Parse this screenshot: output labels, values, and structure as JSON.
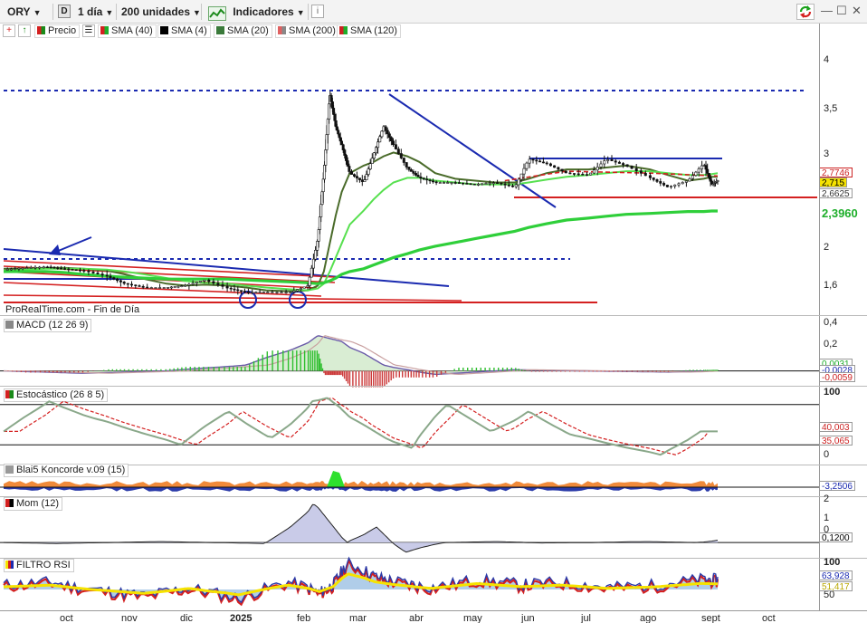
{
  "toolbar": {
    "symbol": "ORY",
    "period_badge": "D",
    "timeframe": "1 día",
    "units": "200 unidades",
    "indicators_label": "Indicadores",
    "info_icon": "info-icon",
    "window_controls": [
      "minimize-icon",
      "restore-icon",
      "close-icon"
    ]
  },
  "legend": {
    "items": [
      {
        "label": "Precio",
        "color": "#2e8b2e"
      },
      {
        "label": "SMA (40)",
        "color": "#1e9e1e"
      },
      {
        "label": "SMA (4)",
        "color": "#000000"
      },
      {
        "label": "SMA (20)",
        "color": "#2e8b57"
      },
      {
        "label": "SMA (200)",
        "color": "#e06060"
      },
      {
        "label": "SMA (120)",
        "color": "#cc2222"
      }
    ]
  },
  "watermark": "ProRealTime.com - Fin de Día",
  "price_axis": {
    "ticks": [
      "4",
      "3,5",
      "3",
      "2",
      "1,6"
    ]
  },
  "price_tags": [
    {
      "value": "2,7746",
      "color": "#cc2222"
    },
    {
      "value": "2,715",
      "color": "#000000"
    },
    {
      "value": "2,6625",
      "color": "#333333"
    },
    {
      "value": "2,3960",
      "color": "#1eae2a"
    }
  ],
  "panels": {
    "macd": {
      "title": "MACD (12 26 9)",
      "ticks": [
        "0,4",
        "0,2",
        "0"
      ],
      "tags": [
        "0,0031",
        "-0,0028",
        "-0,0059"
      ]
    },
    "stoch": {
      "title": "Estocástico (26 8 5)",
      "ticks": [
        "100",
        "0"
      ],
      "tags": [
        "40,003",
        "35,065"
      ]
    },
    "koncorde": {
      "title": "Blai5 Koncorde v.09 (15)",
      "tags": [
        "-3,2506"
      ]
    },
    "mom": {
      "title": "Mom (12)",
      "ticks": [
        "2",
        "1",
        "0"
      ],
      "tags": [
        "0,1200"
      ]
    },
    "rsi": {
      "title": "FILTRO RSI",
      "ticks": [
        "100",
        "50"
      ],
      "tags": [
        "63,928",
        "51,417"
      ]
    }
  },
  "x_axis": {
    "labels": [
      {
        "label": "oct",
        "bold": false
      },
      {
        "label": "nov",
        "bold": false
      },
      {
        "label": "dic",
        "bold": false
      },
      {
        "label": "2025",
        "bold": true
      },
      {
        "label": "feb",
        "bold": false
      },
      {
        "label": "mar",
        "bold": false
      },
      {
        "label": "abr",
        "bold": false
      },
      {
        "label": "may",
        "bold": false
      },
      {
        "label": "jun",
        "bold": false
      },
      {
        "label": "jul",
        "bold": false
      },
      {
        "label": "ago",
        "bold": false
      },
      {
        "label": "sept",
        "bold": false
      },
      {
        "label": "oct",
        "bold": false
      }
    ]
  },
  "chart_data": {
    "type": "line",
    "subtype": "candlestick price chart with indicator panels",
    "symbol": "ORY",
    "timeframe": "1 día",
    "x": [
      "2024-09-10",
      "2024-09-20",
      "2024-10-01",
      "2024-10-10",
      "2024-10-20",
      "2024-11-01",
      "2024-11-10",
      "2024-11-20",
      "2024-12-01",
      "2024-12-10",
      "2024-12-20",
      "2025-01-01",
      "2025-01-10",
      "2025-01-20",
      "2025-02-01",
      "2025-02-10",
      "2025-02-15",
      "2025-02-18",
      "2025-02-21",
      "2025-02-24",
      "2025-02-27",
      "2025-03-03",
      "2025-03-10",
      "2025-03-15",
      "2025-03-20",
      "2025-03-25",
      "2025-04-01",
      "2025-04-07",
      "2025-04-15",
      "2025-04-25",
      "2025-05-05",
      "2025-05-15",
      "2025-05-25",
      "2025-06-01",
      "2025-06-10",
      "2025-06-20",
      "2025-07-01",
      "2025-07-10",
      "2025-07-20",
      "2025-08-01",
      "2025-08-10",
      "2025-08-20",
      "2025-08-28",
      "2025-09-01",
      "2025-09-04"
    ],
    "series": [
      {
        "name": "Precio",
        "values": [
          1.77,
          1.79,
          1.8,
          1.78,
          1.76,
          1.7,
          1.62,
          1.58,
          1.58,
          1.6,
          1.66,
          1.57,
          1.53,
          1.53,
          1.53,
          1.6,
          2.1,
          2.8,
          3.65,
          3.3,
          3.1,
          2.8,
          2.7,
          3.0,
          3.3,
          3.1,
          2.85,
          2.75,
          2.7,
          2.7,
          2.68,
          2.7,
          2.65,
          2.95,
          2.9,
          2.8,
          2.78,
          2.95,
          2.88,
          2.75,
          2.65,
          2.72,
          2.9,
          2.68,
          2.72
        ]
      },
      {
        "name": "SMA (20)",
        "values": [
          1.78,
          1.78,
          1.79,
          1.79,
          1.78,
          1.76,
          1.72,
          1.67,
          1.62,
          1.6,
          1.61,
          1.6,
          1.58,
          1.55,
          1.54,
          1.55,
          1.6,
          1.75,
          2.05,
          2.35,
          2.6,
          2.8,
          2.88,
          2.92,
          2.98,
          3.02,
          2.98,
          2.92,
          2.8,
          2.74,
          2.72,
          2.7,
          2.7,
          2.74,
          2.8,
          2.84,
          2.84,
          2.86,
          2.88,
          2.84,
          2.78,
          2.72,
          2.74,
          2.76,
          2.76
        ]
      },
      {
        "name": "SMA (40)",
        "values": [
          1.76,
          1.77,
          1.78,
          1.78,
          1.78,
          1.77,
          1.75,
          1.72,
          1.68,
          1.65,
          1.63,
          1.62,
          1.6,
          1.58,
          1.56,
          1.55,
          1.57,
          1.62,
          1.75,
          1.9,
          2.05,
          2.25,
          2.4,
          2.52,
          2.62,
          2.7,
          2.75,
          2.75,
          2.72,
          2.7,
          2.68,
          2.68,
          2.68,
          2.7,
          2.73,
          2.76,
          2.78,
          2.8,
          2.82,
          2.82,
          2.8,
          2.78,
          2.78,
          2.79,
          2.8
        ]
      },
      {
        "name": "SMA (120)",
        "values": [
          1.75,
          1.75,
          1.75,
          1.74,
          1.72,
          1.7,
          1.69,
          1.68,
          1.67,
          1.67,
          1.67,
          1.67,
          1.66,
          1.65,
          1.64,
          1.63,
          1.62,
          1.63,
          1.65,
          1.68,
          1.72,
          1.75,
          1.78,
          1.82,
          1.86,
          1.9,
          1.94,
          1.98,
          2.02,
          2.06,
          2.1,
          2.14,
          2.18,
          2.22,
          2.26,
          2.3,
          2.32,
          2.34,
          2.36,
          2.37,
          2.38,
          2.39,
          2.39,
          2.396,
          2.396
        ]
      }
    ],
    "levels": [
      {
        "label": "resistance (dashed)",
        "value": 3.7
      },
      {
        "label": "support (dashed)",
        "value": 1.89
      },
      {
        "label": "range top",
        "value": 2.98
      },
      {
        "label": "range bottom",
        "value": 2.63
      },
      {
        "label": "low support",
        "value": 1.55
      }
    ],
    "ylim": [
      1.45,
      4.3
    ],
    "indicators": {
      "macd": {
        "x": [
          "2024-10",
          "2024-12",
          "2025-01",
          "2025-02",
          "2025-03",
          "2025-03-20",
          "2025-04",
          "2025-05",
          "2025-06",
          "2025-07",
          "2025-08",
          "2025-09"
        ],
        "values": [
          0.0,
          -0.02,
          0.0,
          0.05,
          0.3,
          0.25,
          0.05,
          -0.03,
          0.01,
          0.0,
          -0.01,
          0.003
        ],
        "ylim": [
          -0.08,
          0.42
        ]
      },
      "stochastic": {
        "values": [
          40,
          85,
          60,
          40,
          20,
          70,
          30,
          85,
          90,
          75,
          50,
          30,
          15,
          80,
          40,
          70,
          35,
          20,
          5,
          40,
          40
        ],
        "ylim": [
          0,
          100
        ]
      },
      "momentum": {
        "values": [
          0.0,
          -0.05,
          0.0,
          0.05,
          0.0,
          -0.05,
          2.0,
          1.0,
          0.0,
          0.8,
          -0.5,
          0.0,
          0.05,
          -0.02,
          0.0,
          0.05,
          0.0,
          0.12
        ],
        "ylim": [
          -0.6,
          2.2
        ]
      },
      "rsi": {
        "values": [
          55,
          60,
          45,
          35,
          50,
          30,
          60,
          40,
          55,
          95,
          70,
          60,
          50,
          65,
          55,
          60,
          50,
          55,
          65,
          64
        ],
        "ylim": [
          20,
          100
        ]
      }
    }
  }
}
